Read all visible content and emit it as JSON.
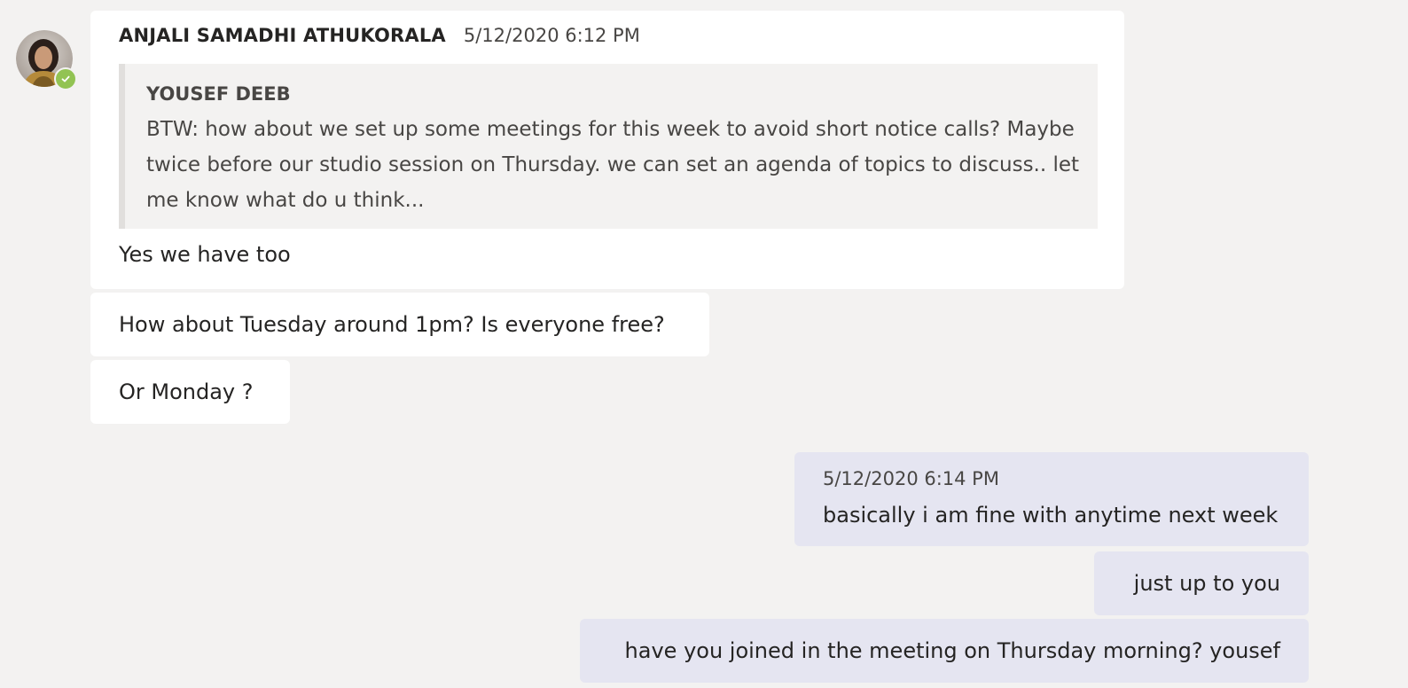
{
  "thread": {
    "incoming": {
      "sender": "ANJALI SAMADHI ATHUKORALA",
      "timestamp": "5/12/2020 6:12 PM",
      "quote": {
        "author": "YOUSEF DEEB",
        "text": "BTW: how about we set up some meetings for this week to avoid short notice calls? Maybe twice before our studio session on Thursday. we can set an agenda of topics to discuss.. let me know what do u think..."
      },
      "messages": [
        "Yes we have too",
        "How about Tuesday around 1pm? Is everyone free?",
        "Or Monday ?"
      ],
      "presence": "available"
    },
    "outgoing": {
      "timestamp": "5/12/2020 6:14 PM",
      "messages": [
        "basically i am fine with anytime next week",
        "just up to you",
        "have you joined in the meeting on Thursday morning? yousef"
      ]
    }
  },
  "colors": {
    "background": "#f3f2f1",
    "incoming_bubble": "#ffffff",
    "outgoing_bubble": "#e5e5f1",
    "presence_available": "#92c353"
  }
}
